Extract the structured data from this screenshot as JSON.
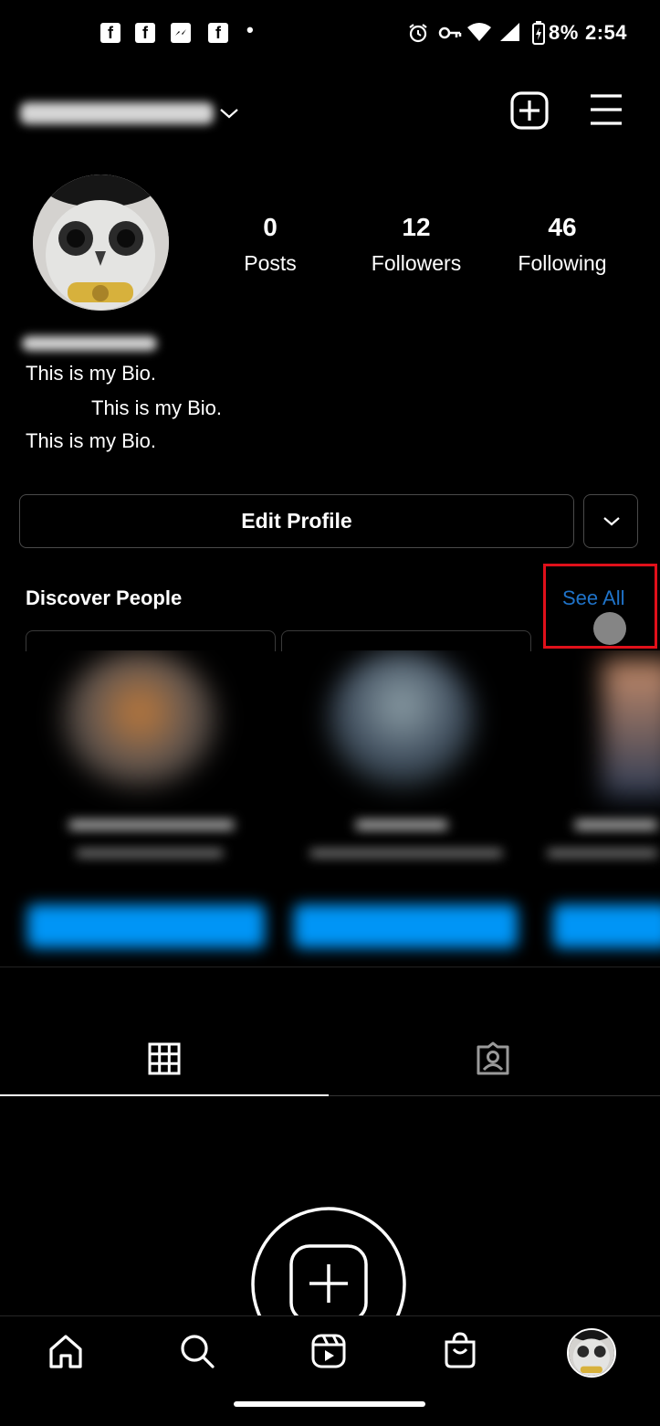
{
  "status_bar": {
    "battery": "8%",
    "time": "2:54",
    "dot": "•"
  },
  "header": {
    "new_post_icon": "plus-square-icon",
    "menu_icon": "hamburger-menu-icon"
  },
  "profile": {
    "posts_count": "0",
    "posts_label": "Posts",
    "followers_count": "12",
    "followers_label": "Followers",
    "following_count": "46",
    "following_label": "Following",
    "bio_lines": [
      "This is my Bio.",
      "This is my Bio.",
      "This is my Bio."
    ]
  },
  "actions": {
    "edit_profile": "Edit Profile"
  },
  "discover": {
    "title": "Discover People",
    "see_all": "See All"
  },
  "colors": {
    "accent": "#1f73c9",
    "follow_blue": "#0095f6",
    "highlight_box": "#e0101a"
  },
  "bottom_nav": [
    "home-icon",
    "search-icon",
    "reels-icon",
    "shop-icon",
    "profile-avatar"
  ]
}
